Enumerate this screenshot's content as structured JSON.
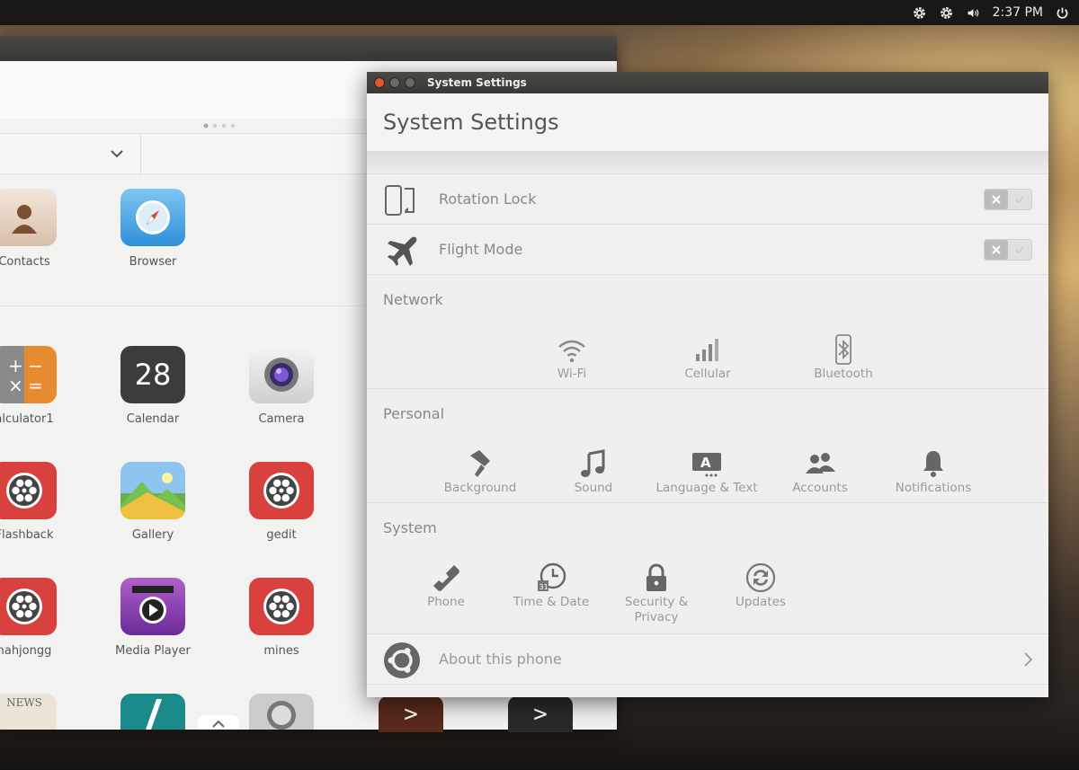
{
  "top_panel": {
    "icons": [
      "gear-icon",
      "gear-icon",
      "volume-icon",
      "power-icon"
    ],
    "clock": "2:37 PM"
  },
  "apps_window": {
    "apps": [
      {
        "label": "Contacts",
        "icon": "contacts-icon"
      },
      {
        "label": "Browser",
        "icon": "browser-icon"
      },
      {
        "label": "alculator1",
        "icon": "calculator-icon"
      },
      {
        "label": "Calendar",
        "icon": "calendar-icon",
        "badge": "28"
      },
      {
        "label": "Camera",
        "icon": "camera-icon"
      },
      {
        "label": "Flashback",
        "icon": "film-reel-icon"
      },
      {
        "label": "Gallery",
        "icon": "gallery-icon"
      },
      {
        "label": "gedit",
        "icon": "film-reel-icon"
      },
      {
        "label": "nahjongg",
        "icon": "film-reel-icon"
      },
      {
        "label": "Media Player",
        "icon": "media-player-icon"
      },
      {
        "label": "mines",
        "icon": "film-reel-icon"
      }
    ],
    "news_label": "NEWS",
    "terminal_glyph": ">"
  },
  "settings": {
    "window_title": "System Settings",
    "heading": "System Settings",
    "toggles": [
      {
        "label": "Rotation Lock",
        "icon": "rotation-lock-icon",
        "on": false
      },
      {
        "label": "Flight Mode",
        "icon": "airplane-icon",
        "on": false
      }
    ],
    "sections": [
      {
        "title": "Network",
        "items": [
          {
            "label": "Wi-Fi",
            "icon": "wifi-icon"
          },
          {
            "label": "Cellular",
            "icon": "cellular-icon"
          },
          {
            "label": "Bluetooth",
            "icon": "bluetooth-icon"
          }
        ]
      },
      {
        "title": "Personal",
        "items": [
          {
            "label": "Background",
            "icon": "paint-roller-icon"
          },
          {
            "label": "Sound",
            "icon": "music-note-icon"
          },
          {
            "label": "Language & Text",
            "icon": "language-icon"
          },
          {
            "label": "Accounts",
            "icon": "accounts-icon"
          },
          {
            "label": "Notifications",
            "icon": "bell-icon"
          }
        ]
      },
      {
        "title": "System",
        "items": [
          {
            "label": "Phone",
            "icon": "phone-icon"
          },
          {
            "label": "Time & Date",
            "icon": "clock-icon"
          },
          {
            "label": "Security & Privacy",
            "icon": "lock-icon"
          },
          {
            "label": "Updates",
            "icon": "updates-icon"
          }
        ]
      }
    ],
    "about": {
      "label": "About this phone",
      "icon": "ubuntu-logo-icon"
    }
  },
  "colors": {
    "close_button": "#e05a2e",
    "film_red": "#d8413d",
    "calculator_orange": "#e88a30",
    "panel_bg": "#1a1816"
  }
}
